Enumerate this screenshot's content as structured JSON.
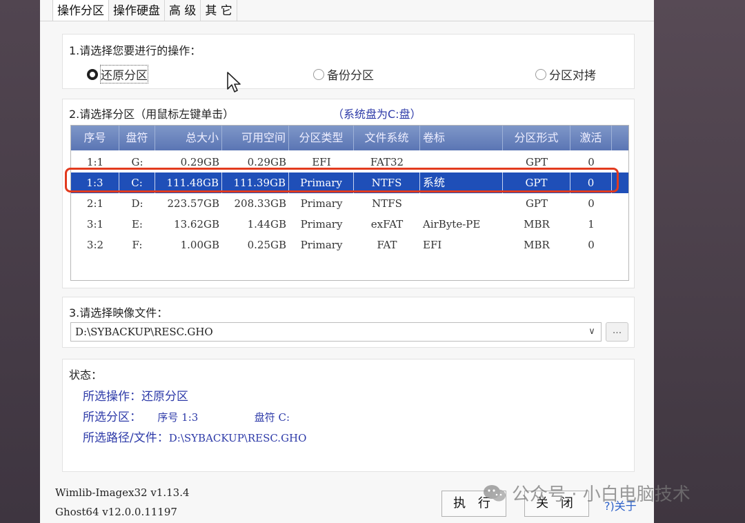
{
  "tabs": [
    "操作分区",
    "操作硬盘",
    "高 级",
    "其 它"
  ],
  "section1": {
    "title": "1.请选择您要进行的操作：",
    "options": [
      "还原分区",
      "备份分区",
      "分区对拷"
    ],
    "selected": "还原分区"
  },
  "section2": {
    "title": "2.请选择分区（用鼠标左键单击）",
    "system_note": "（系统盘为C:盘）",
    "columns": [
      "序号",
      "盘符",
      "总大小",
      "可用空间",
      "分区类型",
      "文件系统",
      "卷标",
      "分区形式",
      "激活"
    ],
    "rows": [
      [
        "1:1",
        "G:",
        "0.29GB",
        "0.29GB",
        "EFI",
        "FAT32",
        "",
        "GPT",
        "0"
      ],
      [
        "1:3",
        "C:",
        "111.48GB",
        "111.39GB",
        "Primary",
        "NTFS",
        "系统",
        "GPT",
        "0"
      ],
      [
        "2:1",
        "D:",
        "223.57GB",
        "208.33GB",
        "Primary",
        "NTFS",
        "",
        "GPT",
        "0"
      ],
      [
        "3:1",
        "E:",
        "13.62GB",
        "1.44GB",
        "Primary",
        "exFAT",
        "AirByte-PE",
        "MBR",
        "1"
      ],
      [
        "3:2",
        "F:",
        "1.00GB",
        "0.25GB",
        "Primary",
        "FAT",
        "EFI",
        "MBR",
        "0"
      ]
    ],
    "selected_row": 1
  },
  "section3": {
    "title": "3.请选择映像文件：",
    "file": "D:\\SYBACKUP\\RESC.GHO",
    "browse": "..."
  },
  "status": {
    "title": "状态：",
    "op_label": "所选操作：",
    "op_value": "还原分区",
    "part_label": "所选分区：",
    "part_seq": "序号 1:3",
    "part_drive": "盘符 C:",
    "path_label": "所选路径/文件：",
    "path_value": "D:\\SYBACKUP\\RESC.GHO"
  },
  "footer": {
    "version1": "Wimlib-Imagex32 v1.13.4",
    "version2": "Ghost64 v12.0.0.11197",
    "execute": "执 行",
    "close": "关 闭",
    "about": "?)关于"
  },
  "watermark": "公众号 · 小白电脑技术",
  "colors": {
    "selection": "#1f4fb8",
    "highlight_box": "#e23a1e",
    "status_text": "#2d3aa8",
    "header": "#6a84be"
  }
}
